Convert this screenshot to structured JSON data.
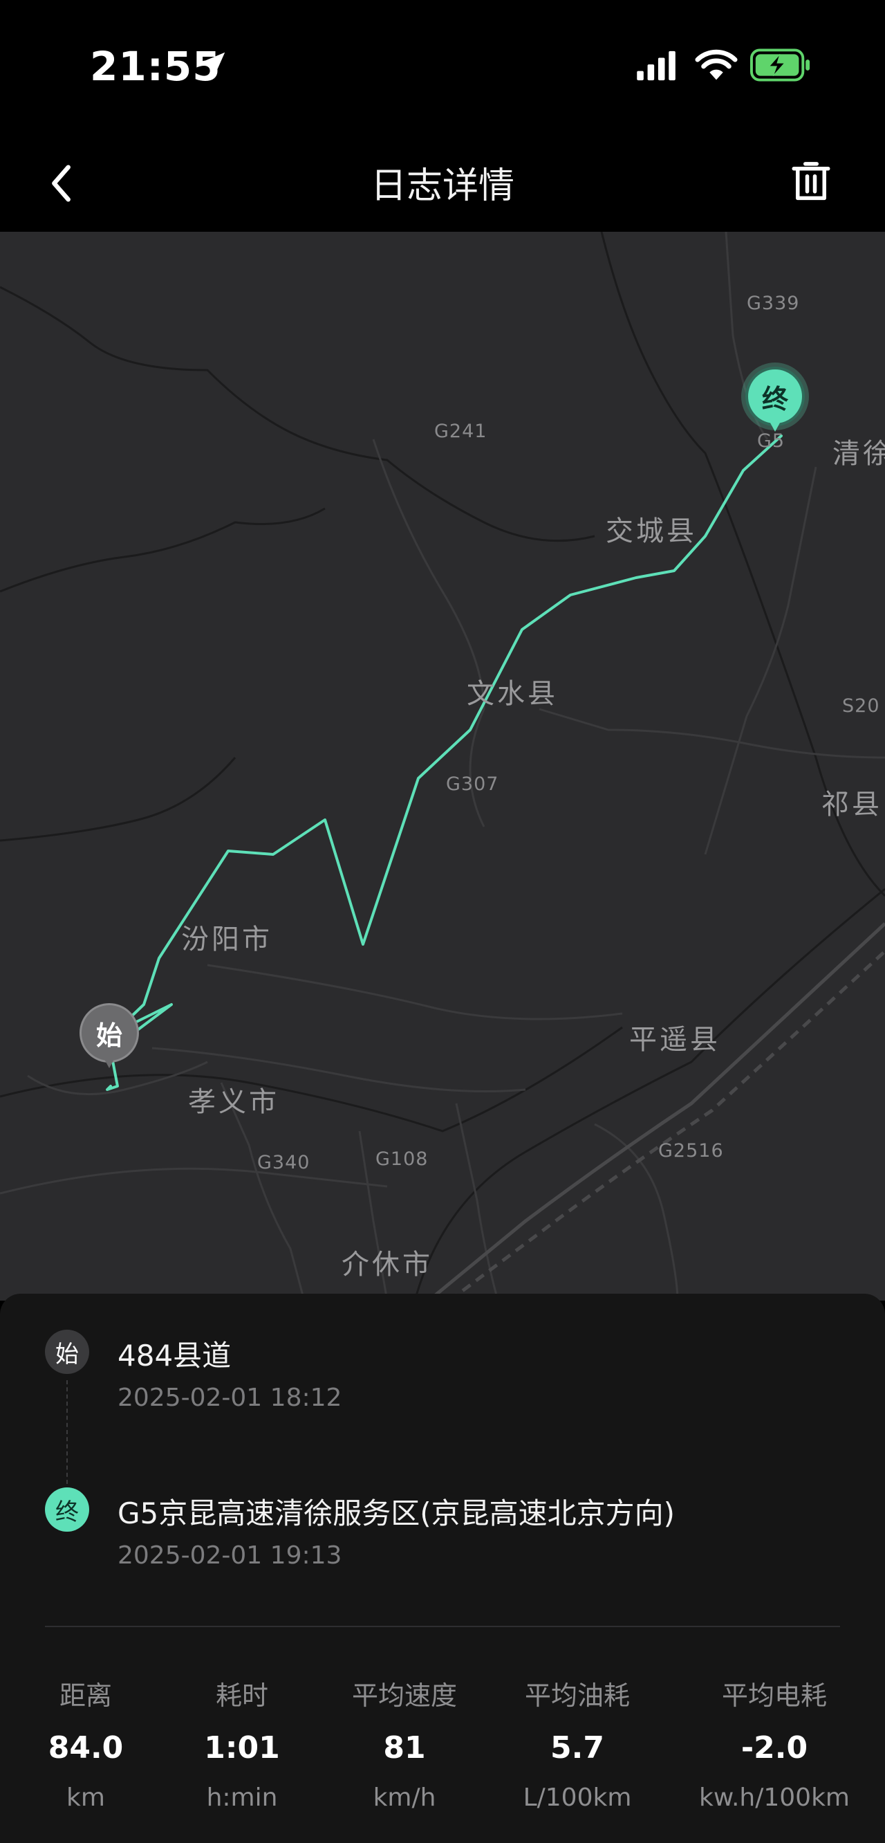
{
  "status_bar": {
    "time": "21:55"
  },
  "nav": {
    "title": "日志详情"
  },
  "map": {
    "cities": [
      "汾阳市",
      "孝义市",
      "文水县",
      "交城县",
      "平遥县",
      "介休市",
      "清徐",
      "祁县"
    ],
    "roads": [
      "G339",
      "G241",
      "G5",
      "G307",
      "G340",
      "G108",
      "G2516",
      "S20"
    ],
    "start_marker": "始",
    "end_marker": "终",
    "route_color": "#5ee0b8"
  },
  "trip": {
    "start": {
      "badge": "始",
      "address": "484县道",
      "time": "2025-02-01 18:12"
    },
    "end": {
      "badge": "终",
      "address": "G5京昆高速清徐服务区(京昆高速北京方向)",
      "time": "2025-02-01 19:13"
    }
  },
  "stats": [
    {
      "label": "距离",
      "value": "84.0",
      "unit": "km"
    },
    {
      "label": "耗时",
      "value": "1:01",
      "unit": "h:min"
    },
    {
      "label": "平均速度",
      "value": "81",
      "unit": "km/h"
    },
    {
      "label": "平均油耗",
      "value": "5.7",
      "unit": "L/100km"
    },
    {
      "label": "平均电耗",
      "value": "-2.0",
      "unit": "kw.h/100km"
    }
  ]
}
